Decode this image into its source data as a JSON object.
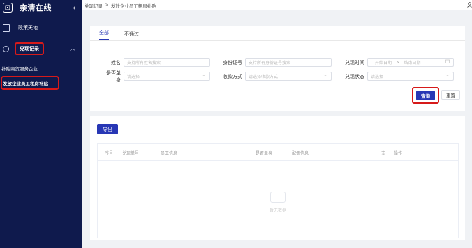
{
  "app": {
    "title": "亲清在线"
  },
  "sidebar": {
    "items": [
      {
        "label": "政策天地"
      }
    ],
    "group": {
      "label": "兑现记录"
    },
    "subitems": [
      {
        "label": "补贴商贸服务企业"
      },
      {
        "label": "发放企业员工租房补贴"
      }
    ]
  },
  "breadcrumb": {
    "parent": "兑现记录",
    "separator": ">",
    "current": "发放企业员工租房补贴"
  },
  "tabs": [
    {
      "label": "全部"
    },
    {
      "label": "不通过"
    }
  ],
  "filters": {
    "name": {
      "label": "姓名",
      "placeholder": "支持所有姓名搜索"
    },
    "idcard": {
      "label": "身份证号",
      "placeholder": "支持所有身份证号搜索"
    },
    "time": {
      "label": "兑现时间",
      "start": "开始日期",
      "sep": "~",
      "end": "结束日期"
    },
    "single": {
      "label": "是否单身",
      "placeholder": "请选择"
    },
    "payment": {
      "label": "收款方式",
      "placeholder": "请选择收款方式"
    },
    "status": {
      "label": "兑现状态",
      "placeholder": "请选择"
    }
  },
  "buttons": {
    "query": "查询",
    "reset": "重置",
    "export": "导出"
  },
  "table": {
    "columns": [
      "序号",
      "兑现单号",
      "员工信息",
      "是否单身",
      "配偶信息",
      "支",
      "操作"
    ],
    "empty_text": "暂无数据"
  }
}
